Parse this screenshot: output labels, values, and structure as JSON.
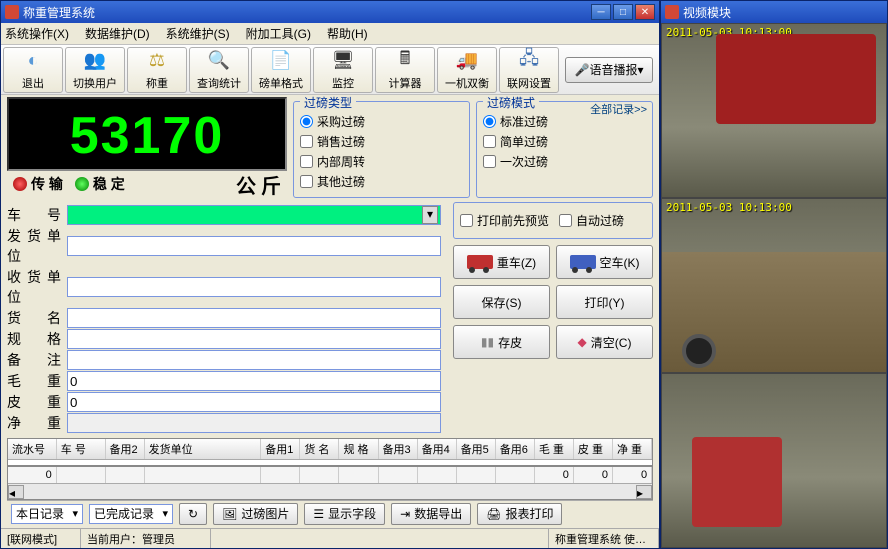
{
  "main_title": "称重管理系统",
  "video_title": "视频模块",
  "menu": [
    "系统操作(X)",
    "数据维护(D)",
    "系统维护(S)",
    "附加工具(G)",
    "帮助(H)"
  ],
  "toolbar": [
    {
      "label": "退出",
      "icon": "👁️",
      "name": "exit"
    },
    {
      "label": "切换用户",
      "icon": "👤",
      "name": "switch-user"
    },
    {
      "label": "称重",
      "icon": "⚖️",
      "name": "weigh"
    },
    {
      "label": "查询统计",
      "icon": "🔍",
      "name": "query"
    },
    {
      "label": "磅单格式",
      "icon": "📋",
      "name": "ticket-format"
    },
    {
      "label": "监控",
      "icon": "🖥️",
      "name": "monitor"
    },
    {
      "label": "计算器",
      "icon": "🧮",
      "name": "calculator"
    },
    {
      "label": "一机双衡",
      "icon": "🚛",
      "name": "dual-scale"
    },
    {
      "label": "联网设置",
      "icon": "🌐",
      "name": "network"
    }
  ],
  "voice_btn": "语音播报",
  "all_records_link": "全部记录>>",
  "weight_display": "53170",
  "status": {
    "transfer": "传 输",
    "stable": "稳 定",
    "unit": "公  斤"
  },
  "group_type": {
    "title": "过磅类型",
    "opts": [
      "采购过磅",
      "销售过磅",
      "内部周转",
      "其他过磅"
    ],
    "selected": 0
  },
  "group_mode": {
    "title": "过磅模式",
    "opts": [
      "标准过磅",
      "简单过磅",
      "一次过磅"
    ],
    "selected": 0
  },
  "checks": {
    "preview": "打印前先预览",
    "auto": "自动过磅"
  },
  "form": {
    "labels": {
      "veh": "车  号",
      "sender": "发货单位",
      "receiver": "收货单位",
      "goods": "货  名",
      "spec": "规  格",
      "note": "备  注",
      "gross": "毛  重",
      "tare": "皮  重",
      "net": "净  重"
    },
    "values": {
      "gross": "0",
      "tare": "0",
      "net": ""
    }
  },
  "buttons": {
    "heavy": "重车(Z)",
    "empty": "空车(K)",
    "save": "保存(S)",
    "print": "打印(Y)",
    "store": "存皮",
    "clear": "清空(C)"
  },
  "table_headers": [
    "流水号",
    "车 号",
    "备用2",
    "发货单位",
    "备用1",
    "货 名",
    "规 格",
    "备用3",
    "备用4",
    "备用5",
    "备用6",
    "毛 重",
    "皮 重",
    "净 重"
  ],
  "footer_vals": [
    "0",
    "",
    "",
    "",
    "",
    "",
    "",
    "",
    "",
    "",
    "",
    "0",
    "0",
    "0"
  ],
  "bottom": {
    "today": "本日记录",
    "done": "已完成记录",
    "btns": [
      "过磅图片",
      "显示字段",
      "数据导出",
      "报表打印"
    ]
  },
  "statusbar": {
    "net_label": "[联网模式]",
    "user_label": "当前用户：",
    "user": "管理员",
    "sys": "称重管理系统 使…"
  },
  "cam_osd": "2011-05-03 10:13:00"
}
